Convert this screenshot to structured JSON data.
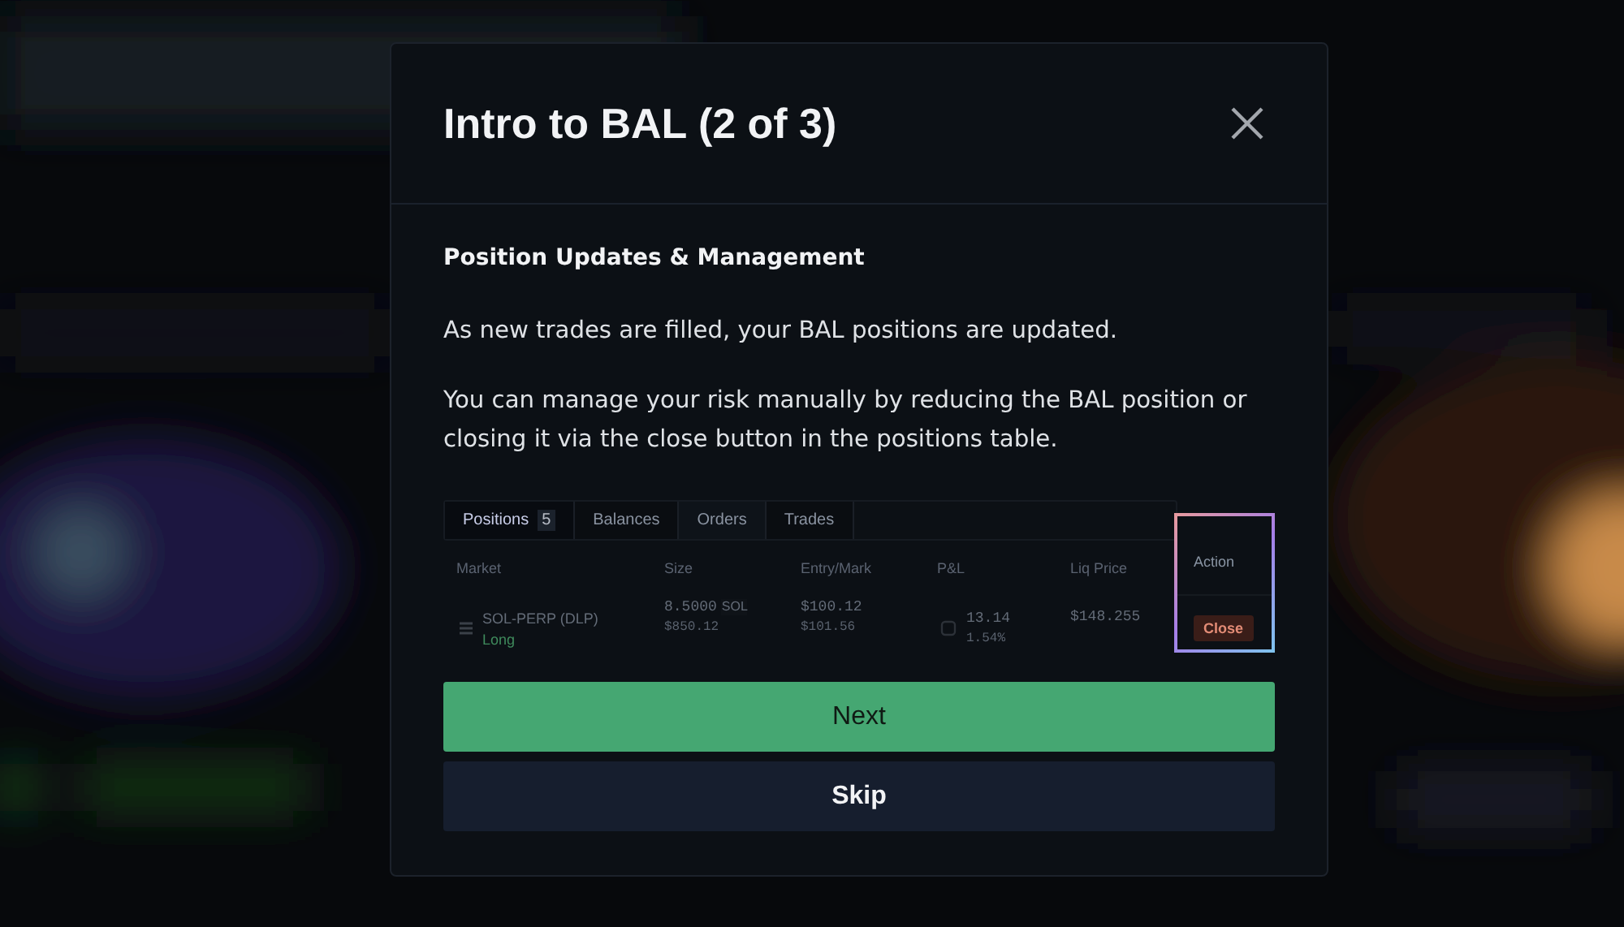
{
  "modal": {
    "title": "Intro to BAL (2 of 3)",
    "heading": "Position Updates & Management",
    "paragraphs": [
      "As new trades are filled, your BAL positions are updated.",
      "You can manage your risk manually by reducing the BAL position or closing it via the close button in the positions table."
    ],
    "preview": {
      "tabs": [
        {
          "label": "Positions",
          "count": "5",
          "selected": true
        },
        {
          "label": "Balances",
          "selected": false
        },
        {
          "label": "Orders",
          "selected": false
        },
        {
          "label": "Trades",
          "selected": false
        }
      ],
      "columns": [
        "Market",
        "Size",
        "Entry/Mark",
        "P&L",
        "Liq Price",
        "Action"
      ],
      "rows": [
        {
          "market": "SOL-PERP (DLP)",
          "side": "Long",
          "size": "8.5000",
          "unit": "SOL",
          "notional": "$850.12",
          "entry": "$100.12",
          "mark": "$101.56",
          "pnl": "13.14",
          "pnl_pct": "1.54%",
          "liq": "$148.255",
          "action": "Close"
        }
      ]
    },
    "buttons": [
      {
        "label": "Next",
        "kind": "primary"
      },
      {
        "label": "Skip",
        "kind": "secondary"
      }
    ]
  }
}
